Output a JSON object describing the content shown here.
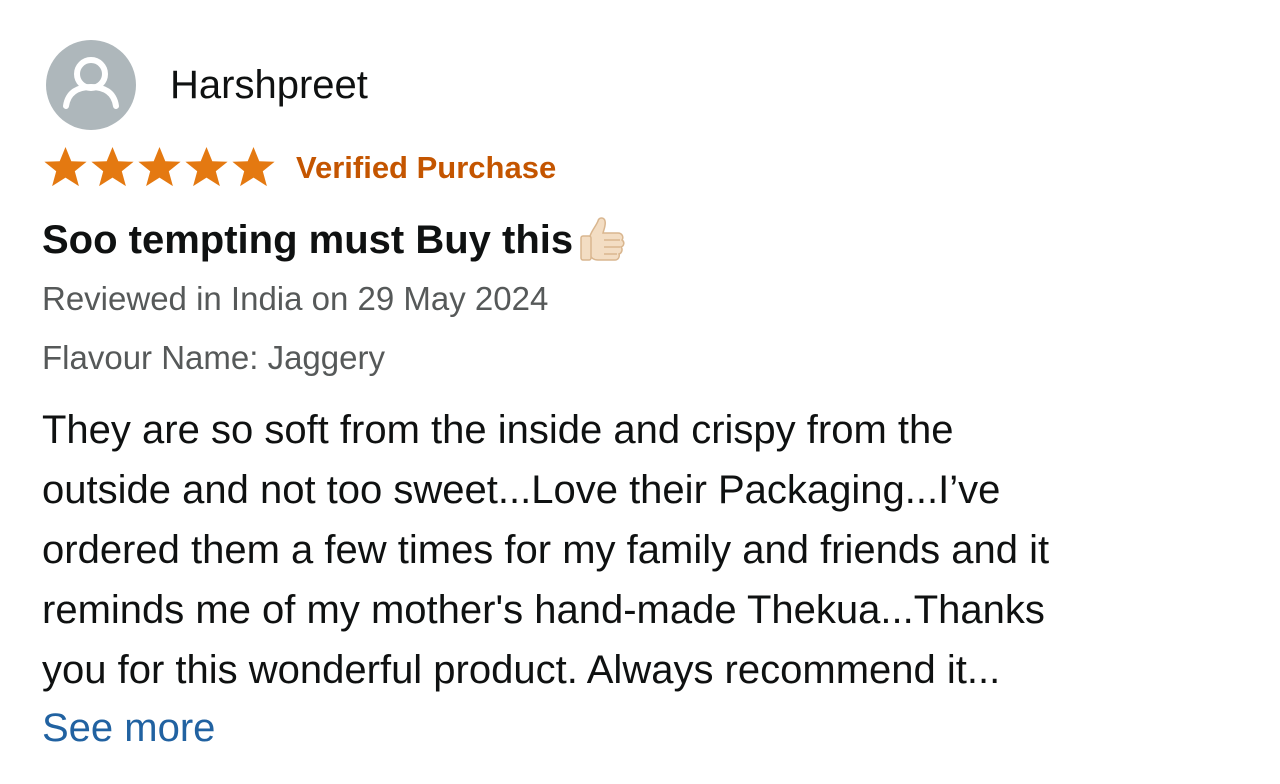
{
  "reviewer": {
    "name": "Harshpreet",
    "avatar_icon": "user-silhouette-icon"
  },
  "rating": {
    "stars": 5,
    "max": 5,
    "star_color": "#e47911",
    "verified_label": "Verified Purchase",
    "verified_color": "#c45500"
  },
  "review": {
    "title": "Soo tempting must Buy this",
    "title_icon": "thumbs-up-icon",
    "reviewed_text": "Reviewed in India on 29 May 2024",
    "flavour_text": "Flavour Name: Jaggery",
    "body_lines": [
      "They are so soft from the inside and crispy from the",
      "outside and not too sweet...Love their Packaging...I’ve",
      "ordered them a few times for my family and friends and it",
      "reminds me of my mother's hand-made Thekua...Thanks",
      "you for this wonderful product. Always recommend it..."
    ],
    "see_more_label": "See more",
    "link_color": "#2162a1"
  }
}
